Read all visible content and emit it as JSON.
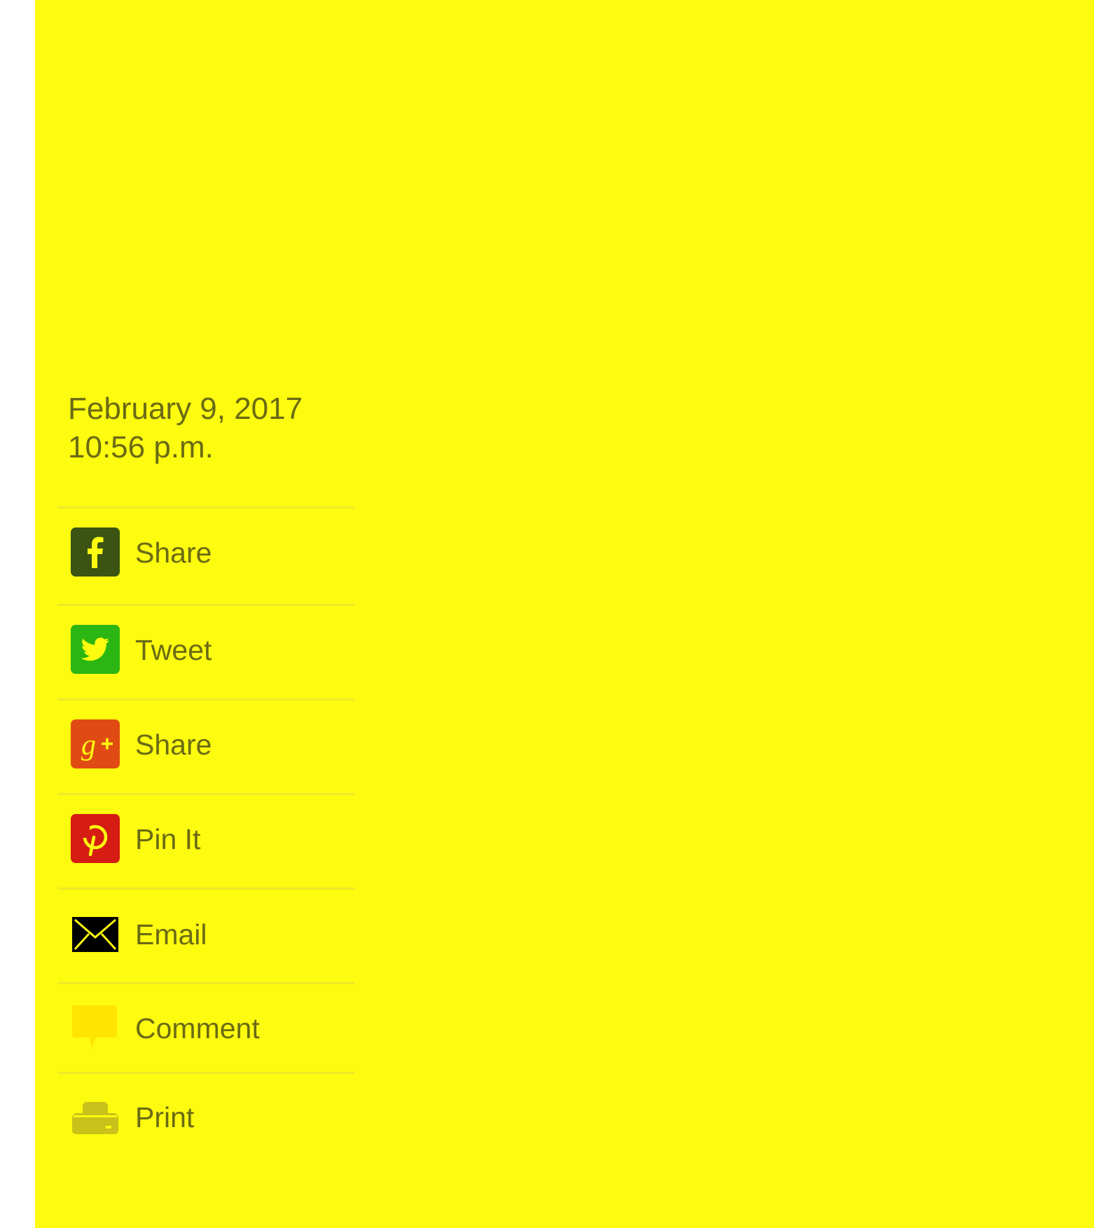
{
  "article": {
    "date": "February 9, 2017",
    "time": "10:56 p.m."
  },
  "share": {
    "items": [
      {
        "id": "facebook",
        "label": "Share",
        "icon": "facebook-icon",
        "color": "#3b5413"
      },
      {
        "id": "twitter",
        "label": "Tweet",
        "icon": "twitter-icon",
        "color": "#2cb613"
      },
      {
        "id": "google-plus",
        "label": "Share",
        "icon": "google-plus-icon",
        "color": "#e04b13"
      },
      {
        "id": "pinterest",
        "label": "Pin It",
        "icon": "pinterest-icon",
        "color": "#d51d13"
      },
      {
        "id": "email",
        "label": "Email",
        "icon": "envelope-icon",
        "color": "#000000"
      },
      {
        "id": "comment",
        "label": "Comment",
        "icon": "speech-bubble-icon",
        "color": "#ffe500"
      },
      {
        "id": "print",
        "label": "Print",
        "icon": "printer-icon",
        "color": "#c8c21a"
      }
    ]
  },
  "colors": {
    "background": "#fdfb0f",
    "text": "#6b6a14",
    "divider": "#ecea29"
  }
}
